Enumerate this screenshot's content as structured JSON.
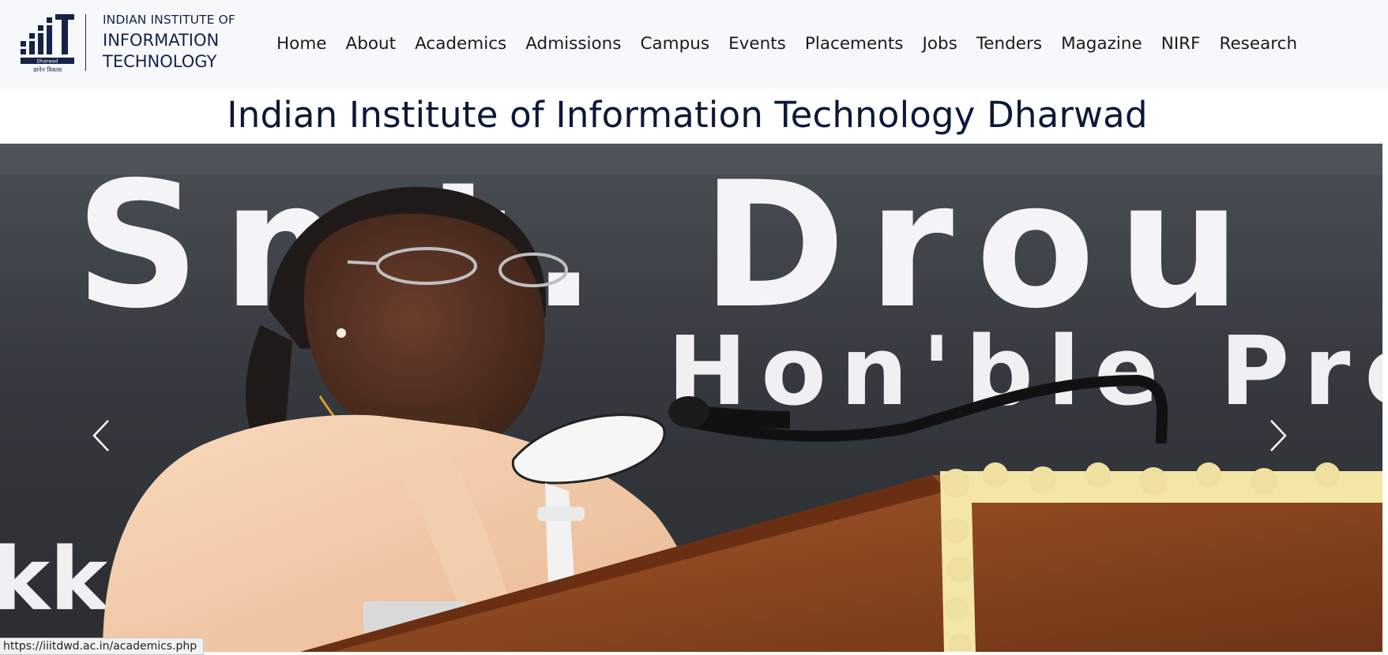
{
  "logo": {
    "line1": "INDIAN INSTITUTE OF",
    "line2": "INFORMATION",
    "line3": "TECHNOLOGY",
    "mark_caption": "Dharwad",
    "mark_tagline": "ज्ञानेन विकास"
  },
  "nav": {
    "items": [
      {
        "label": "Home"
      },
      {
        "label": "About"
      },
      {
        "label": "Academics"
      },
      {
        "label": "Admissions"
      },
      {
        "label": "Campus"
      },
      {
        "label": "Events"
      },
      {
        "label": "Placements"
      },
      {
        "label": "Jobs"
      },
      {
        "label": "Tenders"
      },
      {
        "label": "Magazine"
      },
      {
        "label": "NIRF"
      },
      {
        "label": "Research"
      }
    ]
  },
  "main": {
    "title": "Indian Institute of Information Technology Dharwad"
  },
  "carousel": {
    "slide_banner_line1": "Smt. Drou",
    "slide_banner_line2": "Hon'ble Pre",
    "slide_banner_fragment": "kk",
    "prev_icon": "chevron-left-icon",
    "next_icon": "chevron-right-icon"
  },
  "status_bar": {
    "url": "https://iiitdwd.ac.in/academics.php"
  },
  "colors": {
    "header_bg": "#f7f8fa",
    "brand_navy": "#15234a",
    "title_color": "#0c1838"
  }
}
